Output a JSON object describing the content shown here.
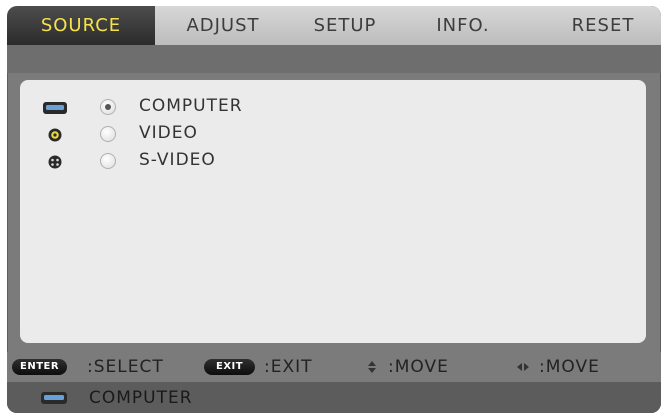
{
  "tabs": [
    {
      "label": "SOURCE",
      "active": true
    },
    {
      "label": "ADJUST",
      "active": false
    },
    {
      "label": "SETUP",
      "active": false
    },
    {
      "label": "INFO.",
      "active": false
    },
    {
      "label": "RESET",
      "active": false
    }
  ],
  "sources": [
    {
      "label": "COMPUTER",
      "icon": "computer-port-icon",
      "selected": true
    },
    {
      "label": "VIDEO",
      "icon": "video-port-icon",
      "selected": false
    },
    {
      "label": "S-VIDEO",
      "icon": "s-video-port-icon",
      "selected": false
    }
  ],
  "help": {
    "enter_key": "ENTER",
    "enter_text": ":SELECT",
    "exit_key": "EXIT",
    "exit_text": ":EXIT",
    "updown_icon": "up-down-arrow-icon",
    "updown_text": ":MOVE",
    "leftright_icon": "left-right-arrow-icon",
    "leftright_text": ":MOVE"
  },
  "status": {
    "icon": "computer-port-icon",
    "label": "COMPUTER"
  },
  "colors": {
    "active_tab_text": "#f5e34a",
    "frame": "#7b7b7b",
    "panel": "#ebebeb"
  }
}
